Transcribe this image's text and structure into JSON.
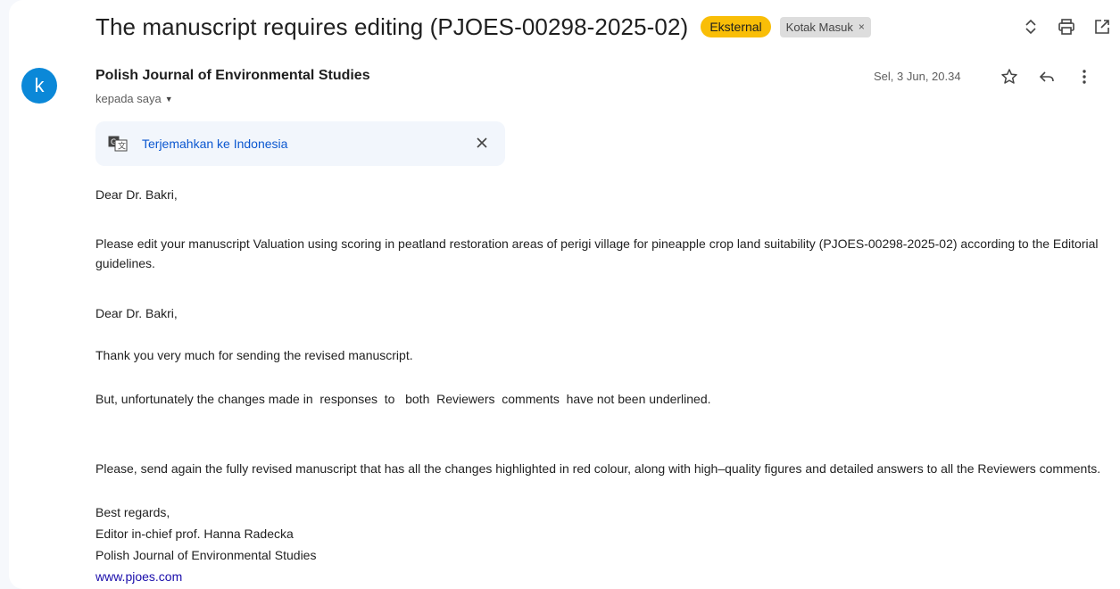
{
  "subject": {
    "title": "The manuscript requires editing (PJOES-00298-2025-02)",
    "label_external": "Eksternal",
    "label_inbox": "Kotak Masuk",
    "label_inbox_remove": "×"
  },
  "message": {
    "avatar_letter": "k",
    "sender": "Polish Journal of Environmental Studies",
    "to": "kepada saya",
    "date": "Sel, 3 Jun, 20.34"
  },
  "translate": {
    "link": "Terjemahkan ke Indonesia"
  },
  "body": {
    "greeting1": "Dear Dr. Bakri,",
    "para1": "Please edit your manuscript Valuation using scoring in peatland restoration areas of perigi village for pineapple crop land suitability (PJOES-00298-2025-02) according to the Editorial guidelines.",
    "greeting2": "Dear Dr. Bakri,",
    "para2": "Thank you very much for sending the revised manuscript.",
    "para3": "But, unfortunately the changes made in  responses  to   both  Reviewers  comments  have not been underlined.",
    "para4": "Please, send again the fully revised manuscript that has all the changes highlighted in red colour, along with high–quality figures and detailed answers to all the Reviewers comments.",
    "closing": "Best regards,",
    "signature1": "Editor in-chief prof. Hanna Radecka",
    "signature2": "Polish Journal of Environmental Studies",
    "website": "www.pjoes.com"
  },
  "colors": {
    "external_label": "#f9be07",
    "avatar": "#0b88d8",
    "link": "#0b57d0"
  }
}
